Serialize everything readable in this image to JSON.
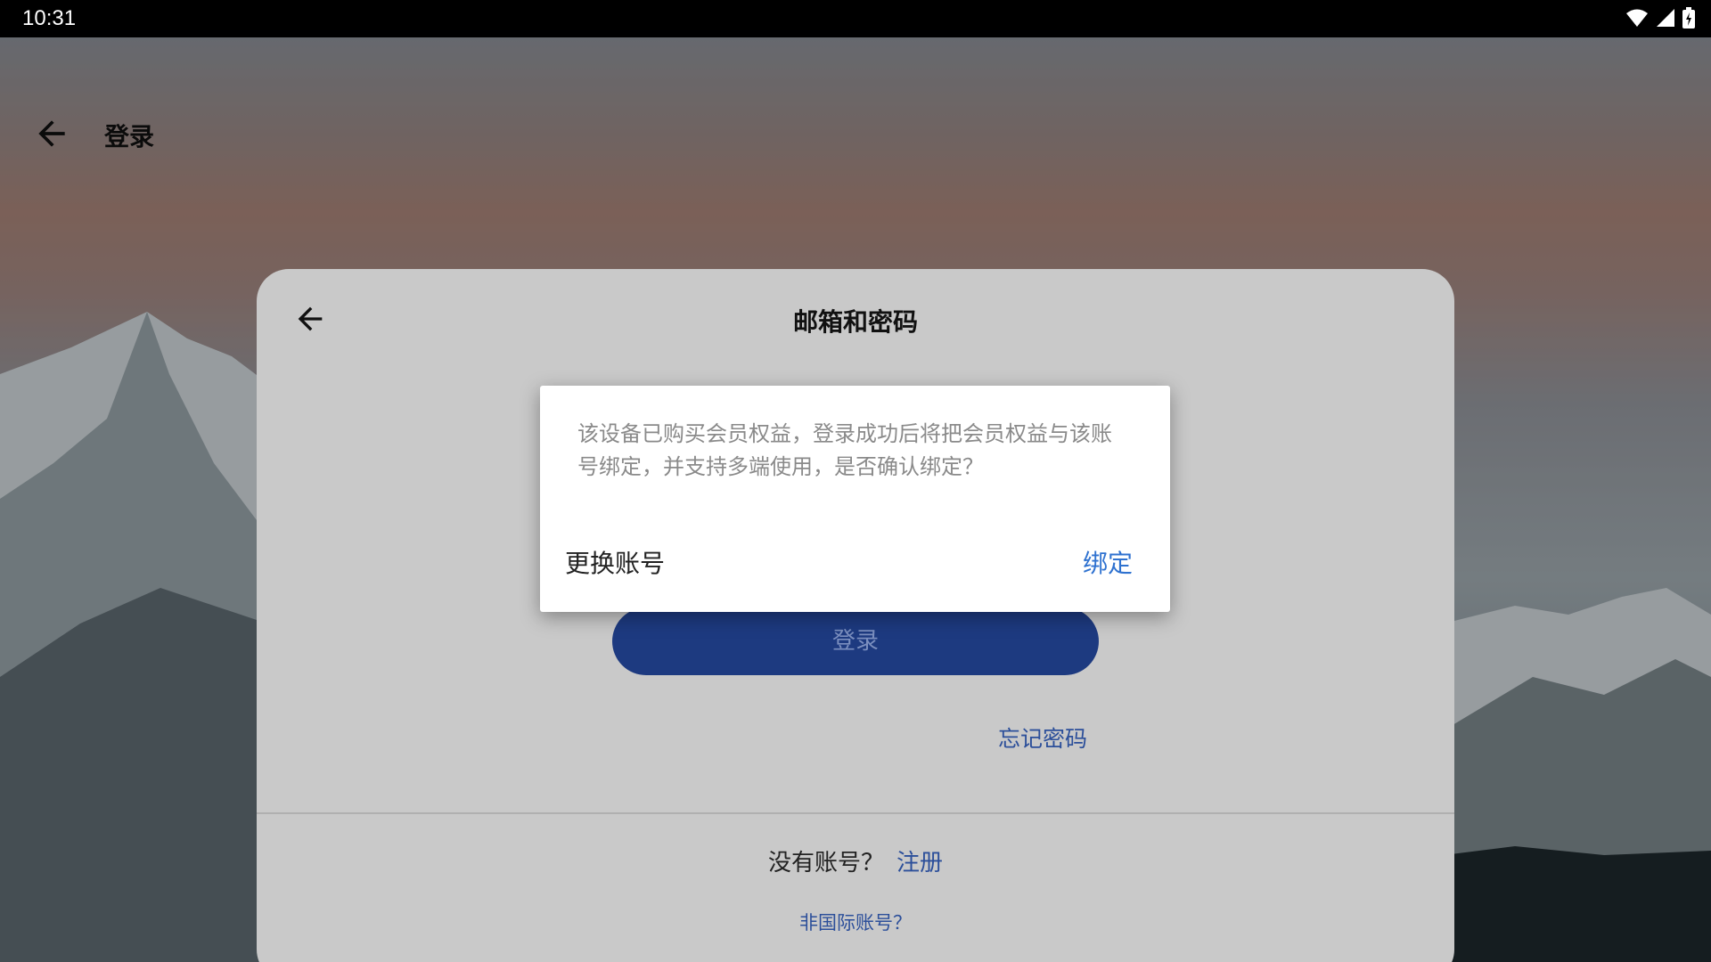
{
  "status_bar": {
    "time": "10:31",
    "icons": [
      "wifi-icon",
      "signal-icon",
      "battery-icon"
    ]
  },
  "app_bar": {
    "back_icon": "arrow-left-icon",
    "title": "登录"
  },
  "card": {
    "back_icon": "arrow-left-icon",
    "title": "邮箱和密码",
    "login_button": "登录",
    "forgot_password": "忘记密码",
    "no_account": "没有账号？",
    "signup": "注册",
    "non_international": "非国际账号？"
  },
  "dialog": {
    "message": "该设备已购买会员权益，登录成功后将把会员权益与该账号绑定，并支持多端使用，是否确认绑定？",
    "switch_account": "更换账号",
    "bind": "绑定"
  },
  "colors": {
    "primary_button": "#1d3a80",
    "link": "#2c4f9a",
    "dialog_accent": "#2f72d0"
  }
}
